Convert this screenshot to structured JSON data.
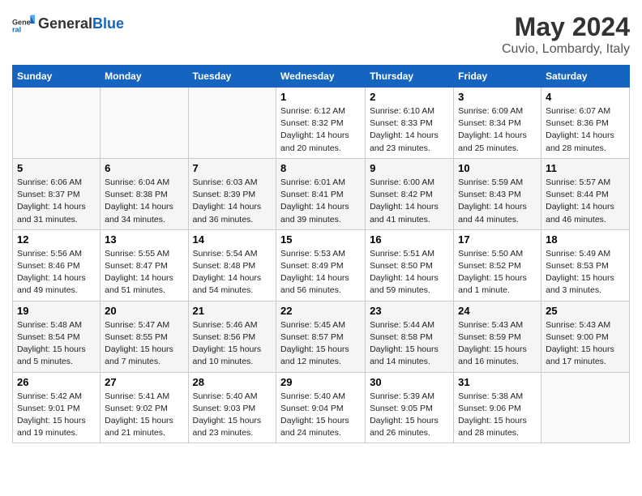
{
  "header": {
    "logo_general": "General",
    "logo_blue": "Blue",
    "month": "May 2024",
    "location": "Cuvio, Lombardy, Italy"
  },
  "weekdays": [
    "Sunday",
    "Monday",
    "Tuesday",
    "Wednesday",
    "Thursday",
    "Friday",
    "Saturday"
  ],
  "weeks": [
    [
      {
        "day": "",
        "info": ""
      },
      {
        "day": "",
        "info": ""
      },
      {
        "day": "",
        "info": ""
      },
      {
        "day": "1",
        "info": "Sunrise: 6:12 AM\nSunset: 8:32 PM\nDaylight: 14 hours\nand 20 minutes."
      },
      {
        "day": "2",
        "info": "Sunrise: 6:10 AM\nSunset: 8:33 PM\nDaylight: 14 hours\nand 23 minutes."
      },
      {
        "day": "3",
        "info": "Sunrise: 6:09 AM\nSunset: 8:34 PM\nDaylight: 14 hours\nand 25 minutes."
      },
      {
        "day": "4",
        "info": "Sunrise: 6:07 AM\nSunset: 8:36 PM\nDaylight: 14 hours\nand 28 minutes."
      }
    ],
    [
      {
        "day": "5",
        "info": "Sunrise: 6:06 AM\nSunset: 8:37 PM\nDaylight: 14 hours\nand 31 minutes."
      },
      {
        "day": "6",
        "info": "Sunrise: 6:04 AM\nSunset: 8:38 PM\nDaylight: 14 hours\nand 34 minutes."
      },
      {
        "day": "7",
        "info": "Sunrise: 6:03 AM\nSunset: 8:39 PM\nDaylight: 14 hours\nand 36 minutes."
      },
      {
        "day": "8",
        "info": "Sunrise: 6:01 AM\nSunset: 8:41 PM\nDaylight: 14 hours\nand 39 minutes."
      },
      {
        "day": "9",
        "info": "Sunrise: 6:00 AM\nSunset: 8:42 PM\nDaylight: 14 hours\nand 41 minutes."
      },
      {
        "day": "10",
        "info": "Sunrise: 5:59 AM\nSunset: 8:43 PM\nDaylight: 14 hours\nand 44 minutes."
      },
      {
        "day": "11",
        "info": "Sunrise: 5:57 AM\nSunset: 8:44 PM\nDaylight: 14 hours\nand 46 minutes."
      }
    ],
    [
      {
        "day": "12",
        "info": "Sunrise: 5:56 AM\nSunset: 8:46 PM\nDaylight: 14 hours\nand 49 minutes."
      },
      {
        "day": "13",
        "info": "Sunrise: 5:55 AM\nSunset: 8:47 PM\nDaylight: 14 hours\nand 51 minutes."
      },
      {
        "day": "14",
        "info": "Sunrise: 5:54 AM\nSunset: 8:48 PM\nDaylight: 14 hours\nand 54 minutes."
      },
      {
        "day": "15",
        "info": "Sunrise: 5:53 AM\nSunset: 8:49 PM\nDaylight: 14 hours\nand 56 minutes."
      },
      {
        "day": "16",
        "info": "Sunrise: 5:51 AM\nSunset: 8:50 PM\nDaylight: 14 hours\nand 59 minutes."
      },
      {
        "day": "17",
        "info": "Sunrise: 5:50 AM\nSunset: 8:52 PM\nDaylight: 15 hours\nand 1 minute."
      },
      {
        "day": "18",
        "info": "Sunrise: 5:49 AM\nSunset: 8:53 PM\nDaylight: 15 hours\nand 3 minutes."
      }
    ],
    [
      {
        "day": "19",
        "info": "Sunrise: 5:48 AM\nSunset: 8:54 PM\nDaylight: 15 hours\nand 5 minutes."
      },
      {
        "day": "20",
        "info": "Sunrise: 5:47 AM\nSunset: 8:55 PM\nDaylight: 15 hours\nand 7 minutes."
      },
      {
        "day": "21",
        "info": "Sunrise: 5:46 AM\nSunset: 8:56 PM\nDaylight: 15 hours\nand 10 minutes."
      },
      {
        "day": "22",
        "info": "Sunrise: 5:45 AM\nSunset: 8:57 PM\nDaylight: 15 hours\nand 12 minutes."
      },
      {
        "day": "23",
        "info": "Sunrise: 5:44 AM\nSunset: 8:58 PM\nDaylight: 15 hours\nand 14 minutes."
      },
      {
        "day": "24",
        "info": "Sunrise: 5:43 AM\nSunset: 8:59 PM\nDaylight: 15 hours\nand 16 minutes."
      },
      {
        "day": "25",
        "info": "Sunrise: 5:43 AM\nSunset: 9:00 PM\nDaylight: 15 hours\nand 17 minutes."
      }
    ],
    [
      {
        "day": "26",
        "info": "Sunrise: 5:42 AM\nSunset: 9:01 PM\nDaylight: 15 hours\nand 19 minutes."
      },
      {
        "day": "27",
        "info": "Sunrise: 5:41 AM\nSunset: 9:02 PM\nDaylight: 15 hours\nand 21 minutes."
      },
      {
        "day": "28",
        "info": "Sunrise: 5:40 AM\nSunset: 9:03 PM\nDaylight: 15 hours\nand 23 minutes."
      },
      {
        "day": "29",
        "info": "Sunrise: 5:40 AM\nSunset: 9:04 PM\nDaylight: 15 hours\nand 24 minutes."
      },
      {
        "day": "30",
        "info": "Sunrise: 5:39 AM\nSunset: 9:05 PM\nDaylight: 15 hours\nand 26 minutes."
      },
      {
        "day": "31",
        "info": "Sunrise: 5:38 AM\nSunset: 9:06 PM\nDaylight: 15 hours\nand 28 minutes."
      },
      {
        "day": "",
        "info": ""
      }
    ]
  ]
}
